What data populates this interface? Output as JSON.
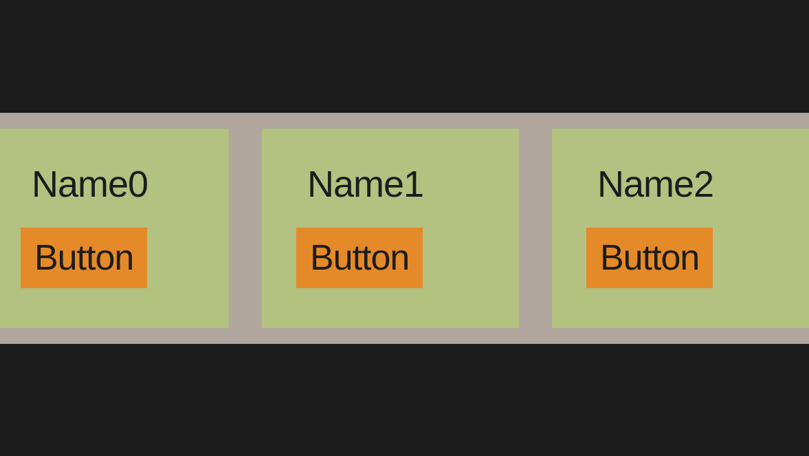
{
  "cards": [
    {
      "name": "Name0",
      "button_label": "Button"
    },
    {
      "name": "Name1",
      "button_label": "Button"
    },
    {
      "name": "Name2",
      "button_label": "Button"
    }
  ]
}
